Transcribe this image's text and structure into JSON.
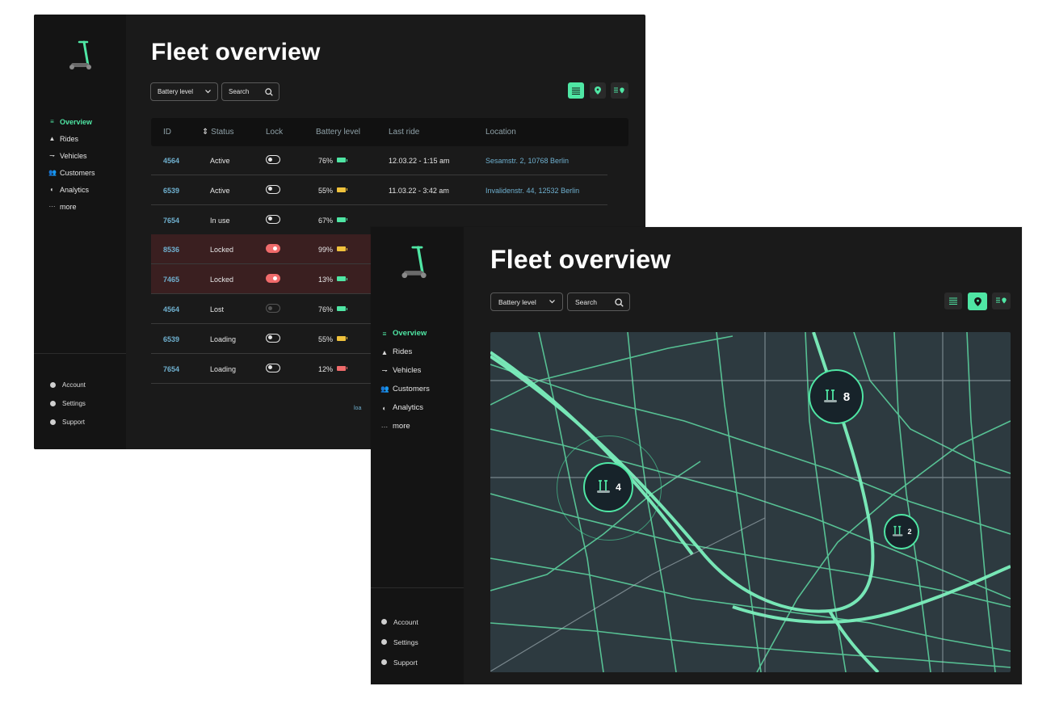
{
  "brand": {
    "accent": "#4fe6a4",
    "background": "#1a1a1a",
    "sidebar": "#141414",
    "link": "#6fb0cf",
    "locked_row": "#3a1f20",
    "toggle_on": "#f06b6b"
  },
  "page_title": "Fleet overview",
  "filters": {
    "battery_dropdown": "Battery level",
    "search_placeholder": "Search"
  },
  "nav": [
    {
      "icon": "list-icon",
      "glyph": "≡",
      "label": "Overview",
      "active": true
    },
    {
      "icon": "rides-icon",
      "glyph": "▲",
      "label": "Rides",
      "active": false
    },
    {
      "icon": "scooter-icon",
      "glyph": "⇁",
      "label": "Vehicles",
      "active": false
    },
    {
      "icon": "customers-icon",
      "glyph": "👥",
      "label": "Customers",
      "active": false
    },
    {
      "icon": "analytics-icon",
      "glyph": "◐",
      "label": "Analytics",
      "active": false
    },
    {
      "icon": "more-icon",
      "glyph": "···",
      "label": "more",
      "active": false
    }
  ],
  "bottom_nav": [
    {
      "icon": "account-icon",
      "label": "Account"
    },
    {
      "icon": "settings-icon",
      "label": "Settings"
    },
    {
      "icon": "support-icon",
      "label": "Support"
    }
  ],
  "view_modes": [
    {
      "icon": "list-view-icon",
      "name": "List view"
    },
    {
      "icon": "map-pin-icon",
      "name": "Map view"
    },
    {
      "icon": "list-map-icon",
      "name": "List and map view"
    }
  ],
  "table": {
    "columns": [
      "ID",
      "Status",
      "Lock",
      "Battery level",
      "Last ride",
      "Location"
    ],
    "rows": [
      {
        "id": "4564",
        "status": "Active",
        "lock": "off",
        "battery": "76%",
        "battery_color": "#4fe6a4",
        "last_ride": "12.03.22 - 1:15 am",
        "location": "Sesamstr. 2, 10768 Berlin"
      },
      {
        "id": "6539",
        "status": "Active",
        "lock": "off",
        "battery": "55%",
        "battery_color": "#f0c23c",
        "last_ride": "11.03.22 - 3:42 am",
        "location": "Invalidenstr. 44, 12532 Berlin"
      },
      {
        "id": "7654",
        "status": "In use",
        "lock": "off",
        "battery": "67%",
        "battery_color": "#4fe6a4",
        "last_ride": "",
        "location": ""
      },
      {
        "id": "8536",
        "status": "Locked",
        "lock": "on",
        "battery": "99%",
        "battery_color": "#f0c23c",
        "last_ride": "",
        "location": ""
      },
      {
        "id": "7465",
        "status": "Locked",
        "lock": "on",
        "battery": "13%",
        "battery_color": "#4fe6a4",
        "last_ride": "",
        "location": ""
      },
      {
        "id": "4564",
        "status": "Lost",
        "lock": "disabled",
        "battery": "76%",
        "battery_color": "#4fe6a4",
        "last_ride": "",
        "location": ""
      },
      {
        "id": "6539",
        "status": "Loading",
        "lock": "off",
        "battery": "55%",
        "battery_color": "#f0c23c",
        "last_ride": "",
        "location": ""
      },
      {
        "id": "7654",
        "status": "Loading",
        "lock": "off",
        "battery": "12%",
        "battery_color": "#f06b6b",
        "last_ride": "",
        "location": ""
      }
    ],
    "footer_fragment": "loa"
  },
  "map": {
    "clusters": [
      {
        "count": "8"
      },
      {
        "count": "4"
      },
      {
        "count": "2"
      }
    ]
  }
}
